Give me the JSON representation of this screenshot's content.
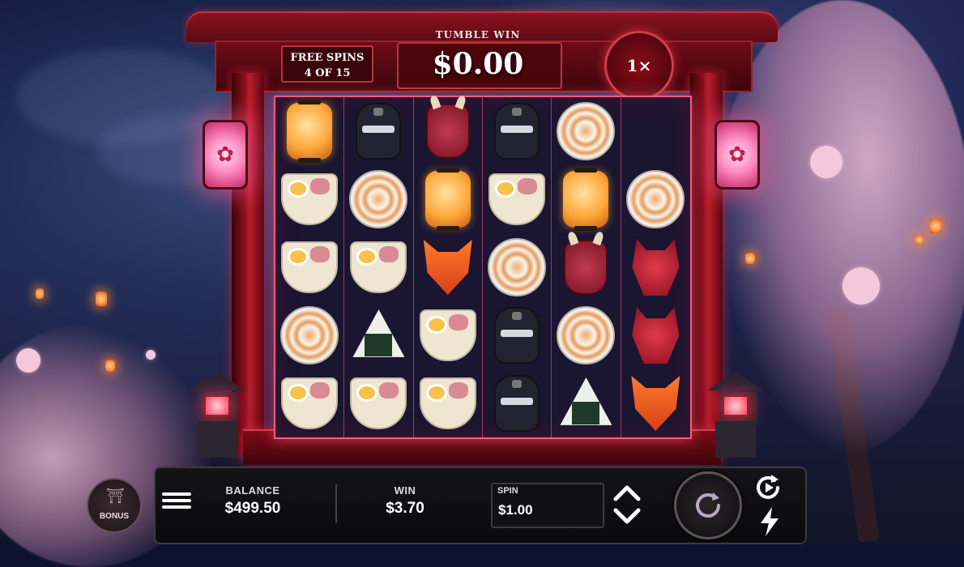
{
  "header": {
    "free_spins_title": "FREE SPINS",
    "free_spins_count": "4 OF 15",
    "tumble_win_label": "TUMBLE WIN",
    "tumble_win_value": "$0.00",
    "multiplier": "1×"
  },
  "reels": {
    "rows": [
      [
        "lantern",
        "ninja",
        "oni-mask",
        "ninja",
        "sushi-roll",
        ""
      ],
      [
        "ramen",
        "sushi-roll",
        "lantern",
        "ramen",
        "lantern",
        "sushi-roll"
      ],
      [
        "ramen",
        "ramen",
        "fox-mask",
        "sushi-roll",
        "oni-mask",
        "dragon-mask"
      ],
      [
        "sushi-roll",
        "onigiri",
        "ramen",
        "ninja",
        "sushi-roll",
        "dragon-mask"
      ],
      [
        "ramen",
        "ramen",
        "ramen",
        "ninja",
        "onigiri",
        "fox-mask"
      ]
    ]
  },
  "controls": {
    "balance_label": "BALANCE",
    "balance_value": "$499.50",
    "win_label": "WIN",
    "win_value": "$3.70",
    "spin_label": "SPIN",
    "spin_value": "$1.00",
    "bonus_label": "BONUS"
  },
  "icons": {
    "menu": "hamburger-icon",
    "bet_up": "chevron-up-icon",
    "bet_down": "chevron-down-icon",
    "spin": "refresh-icon",
    "autoplay": "autoplay-icon",
    "turbo": "lightning-icon",
    "bonus": "torii-gate-icon"
  },
  "colors": {
    "frame_red": "#8a0e1c",
    "grid_glow": "#ff5a78",
    "bar_bg": "#141418",
    "text": "#ffffff"
  }
}
